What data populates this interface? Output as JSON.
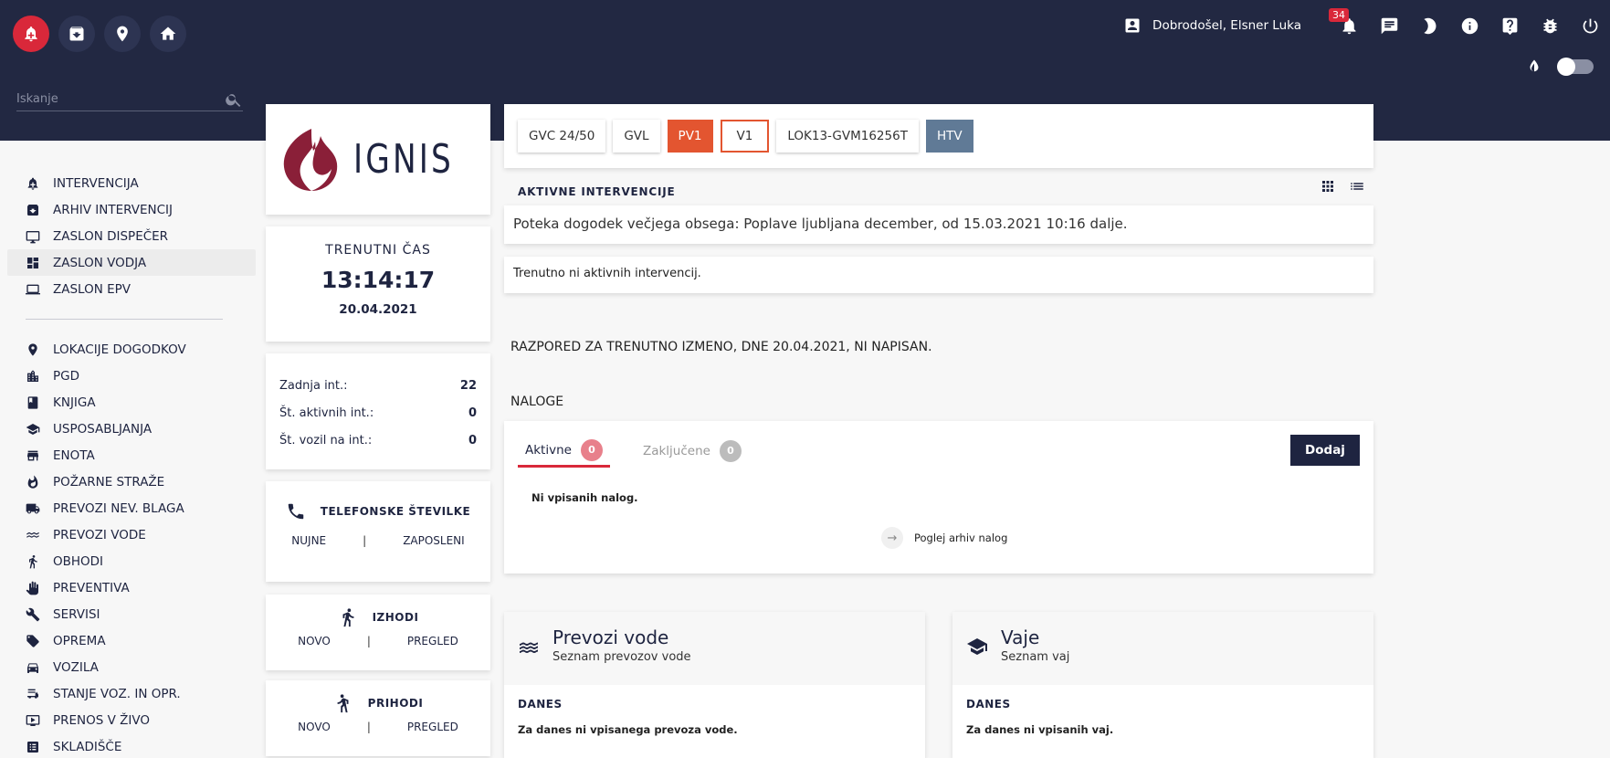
{
  "header": {
    "user_name": "Dobrodošel, Elsner Luka",
    "notifications_count": "34",
    "search_placeholder": "Iskanje"
  },
  "sidebar": {
    "group1": [
      {
        "label": "INTERVENCIJA",
        "icon": "alarm-bell-icon"
      },
      {
        "label": "ARHIV INTERVENCIJ",
        "icon": "archive-icon"
      },
      {
        "label": "ZASLON DISPEČER",
        "icon": "monitor-icon"
      },
      {
        "label": "ZASLON VODJA",
        "icon": "dashboard-icon",
        "active": true
      },
      {
        "label": "ZASLON EPV",
        "icon": "laptop-icon"
      }
    ],
    "group2": [
      {
        "label": "LOKACIJE DOGODKOV",
        "icon": "location-pin-icon"
      },
      {
        "label": "PGD",
        "icon": "building-icon"
      },
      {
        "label": "KNJIGA",
        "icon": "book-icon"
      },
      {
        "label": "USPOSABLJANJA",
        "icon": "graduation-cap-icon"
      },
      {
        "label": "ENOTA",
        "icon": "store-icon"
      },
      {
        "label": "POŽARNE STRAŽE",
        "icon": "fire-icon"
      },
      {
        "label": "PREVOZI NEV. BLAGA",
        "icon": "hazard-truck-icon"
      },
      {
        "label": "PREVOZI VODE",
        "icon": "water-icon"
      },
      {
        "label": "OBHODI",
        "icon": "walking-icon"
      },
      {
        "label": "PREVENTIVA",
        "icon": "hand-icon"
      },
      {
        "label": "SERVISI",
        "icon": "wrench-icon"
      },
      {
        "label": "OPREMA",
        "icon": "tag-icon"
      },
      {
        "label": "VOZILA",
        "icon": "car-icon"
      },
      {
        "label": "STANJE VOZ. IN OPR.",
        "icon": "vehicle-status-icon"
      },
      {
        "label": "PRENOS V ŽIVO",
        "icon": "live-stream-icon"
      },
      {
        "label": "SKLADIŠČE",
        "icon": "warehouse-icon"
      }
    ]
  },
  "logo": {
    "text": "IGNIS"
  },
  "time_card": {
    "title": "TRENUTNI ČAS",
    "time": "13:14:17",
    "date": "20.04.2021"
  },
  "stats": [
    {
      "label": "Zadnja int.:",
      "value": "22"
    },
    {
      "label": "Št. aktivnih int.:",
      "value": "0"
    },
    {
      "label": "Št. vozil na int.:",
      "value": "0"
    }
  ],
  "phone_card": {
    "title": "TELEFONSKE ŠTEVILKE",
    "link1": "NUJNE",
    "link2": "ZAPOSLENI"
  },
  "exits_card": {
    "title": "IZHODI",
    "link1": "NOVO",
    "link2": "PREGLED"
  },
  "arrivals_card": {
    "title": "PRIHODI",
    "link1": "NOVO",
    "link2": "PREGLED"
  },
  "vehicles": [
    "GVC 24/50",
    "GVL",
    "PV1",
    "V1",
    "LOK13-GVM16256T",
    "HTV"
  ],
  "active_interventions": {
    "label": "AKTIVNE INTERVENCIJE",
    "event_text": "Poteka dogodek večjega obsega: Poplave ljubljana december, od 15.03.2021 10:16 dalje.",
    "none_text": "Trenutno ni aktivnih intervencij."
  },
  "schedule_text": "RAZPORED ZA TRENUTNO IZMENO, DNE 20.04.2021, NI NAPISAN.",
  "tasks": {
    "label": "NALOGE",
    "tab_active": "Aktivne",
    "tab_active_count": "0",
    "tab_closed": "Zaključene",
    "tab_closed_count": "0",
    "add_label": "Dodaj",
    "empty_text": "Ni vpisanih nalog.",
    "archive_link": "Poglej arhiv nalog"
  },
  "water_card": {
    "title": "Prevozi vode",
    "subtitle": "Seznam prevozov vode",
    "section": "DANES",
    "empty": "Za danes ni vpisanega prevoza vode."
  },
  "exercise_card": {
    "title": "Vaje",
    "subtitle": "Seznam vaj",
    "section": "DANES",
    "empty": "Za danes ni vpisanih vaj."
  },
  "colors": {
    "header_bg": "#222842",
    "alarm_red": "#d9283a",
    "vehicle_orange": "#e35530",
    "vehicle_slate": "#607a96",
    "brand_dark": "#1e2440"
  }
}
